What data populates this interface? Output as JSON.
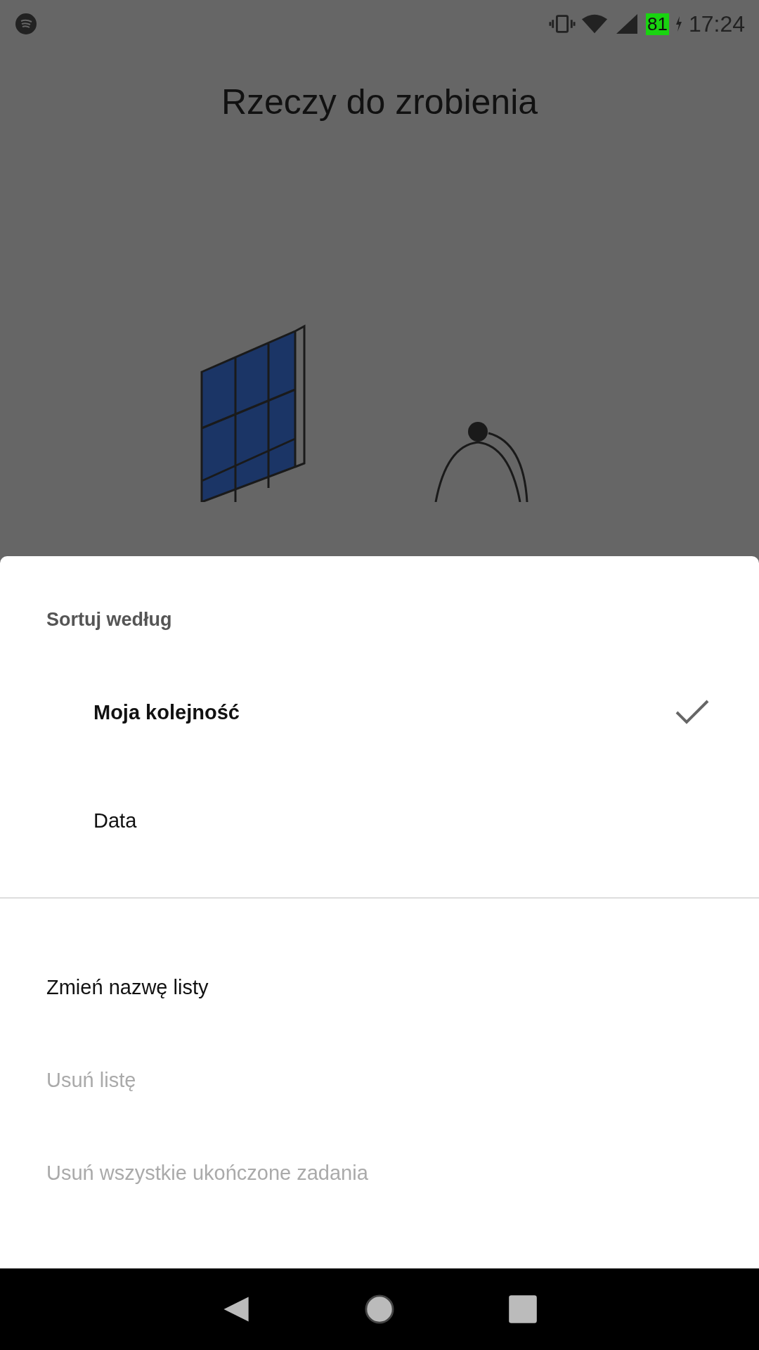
{
  "status_bar": {
    "battery": "81",
    "time": "17:24"
  },
  "page": {
    "title": "Rzeczy do zrobienia"
  },
  "sheet": {
    "sort_heading": "Sortuj według",
    "sort_options": [
      {
        "label": "Moja kolejność",
        "selected": true
      },
      {
        "label": "Data",
        "selected": false
      }
    ],
    "actions": [
      {
        "label": "Zmień nazwę listy",
        "disabled": false
      },
      {
        "label": "Usuń listę",
        "disabled": true
      },
      {
        "label": "Usuń wszystkie ukończone zadania",
        "disabled": true
      }
    ]
  }
}
